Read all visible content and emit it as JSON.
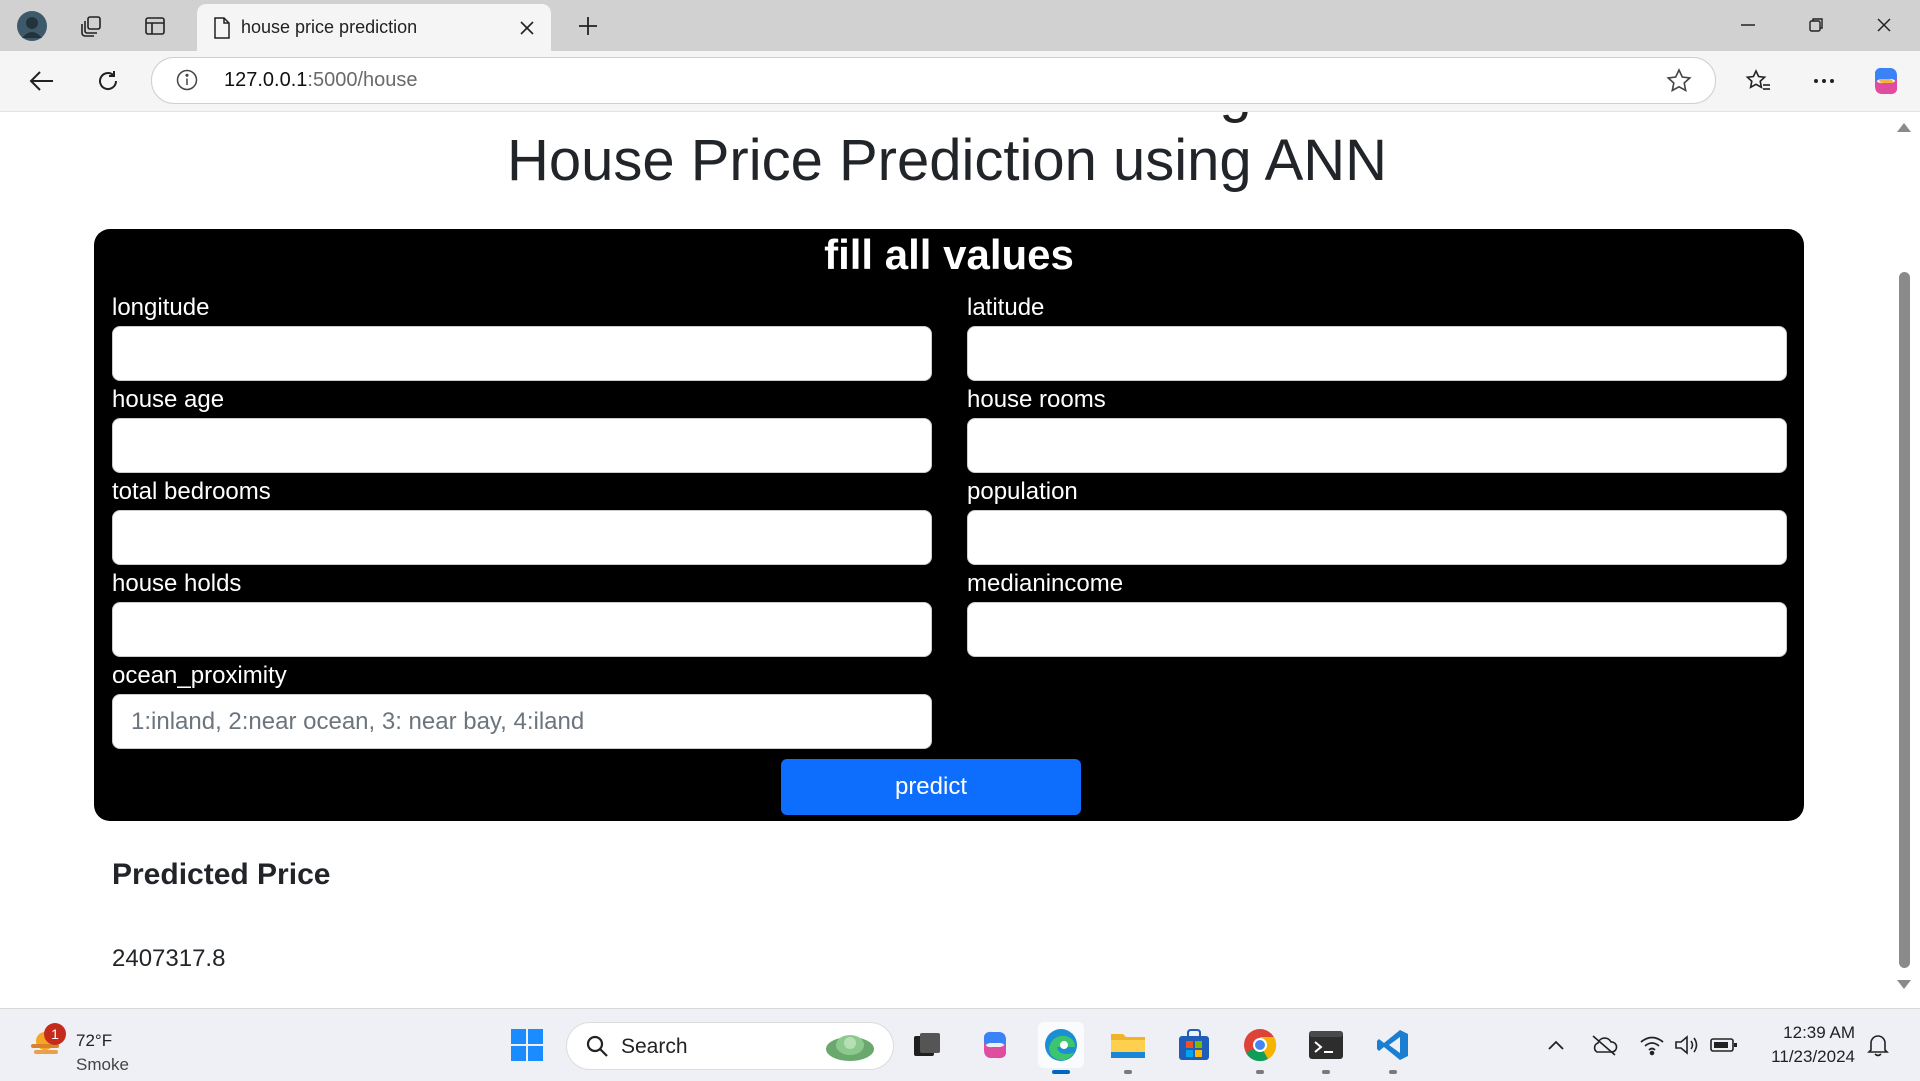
{
  "browser": {
    "tab_title": "house price prediction",
    "url_host": "127.0.0.1",
    "url_rest": ":5000/house"
  },
  "page": {
    "title": "House Price Prediction using ANN",
    "form": {
      "heading": "fill all values",
      "fields": [
        {
          "label": "longitude",
          "value": "",
          "placeholder": ""
        },
        {
          "label": "latitude",
          "value": "",
          "placeholder": ""
        },
        {
          "label": "house age",
          "value": "",
          "placeholder": ""
        },
        {
          "label": "house rooms",
          "value": "",
          "placeholder": ""
        },
        {
          "label": "total bedrooms",
          "value": "",
          "placeholder": ""
        },
        {
          "label": "population",
          "value": "",
          "placeholder": ""
        },
        {
          "label": "house holds",
          "value": "",
          "placeholder": ""
        },
        {
          "label": "medianincome",
          "value": "",
          "placeholder": ""
        },
        {
          "label": "ocean_proximity",
          "value": "",
          "placeholder": "1:inland, 2:near ocean, 3: near bay, 4:iland"
        }
      ],
      "submit_label": "predict"
    },
    "result": {
      "title": "Predicted Price",
      "value": "2407317.8"
    }
  },
  "taskbar": {
    "weather": {
      "badge": "1",
      "temp": "72°F",
      "condition": "Smoke"
    },
    "search_label": "Search",
    "clock": {
      "time": "12:39 AM",
      "date": "11/23/2024"
    }
  },
  "colors": {
    "accent_button": "#0d6efd",
    "form_background": "#000000",
    "taskbar_active_indicator": "#0067c0"
  }
}
